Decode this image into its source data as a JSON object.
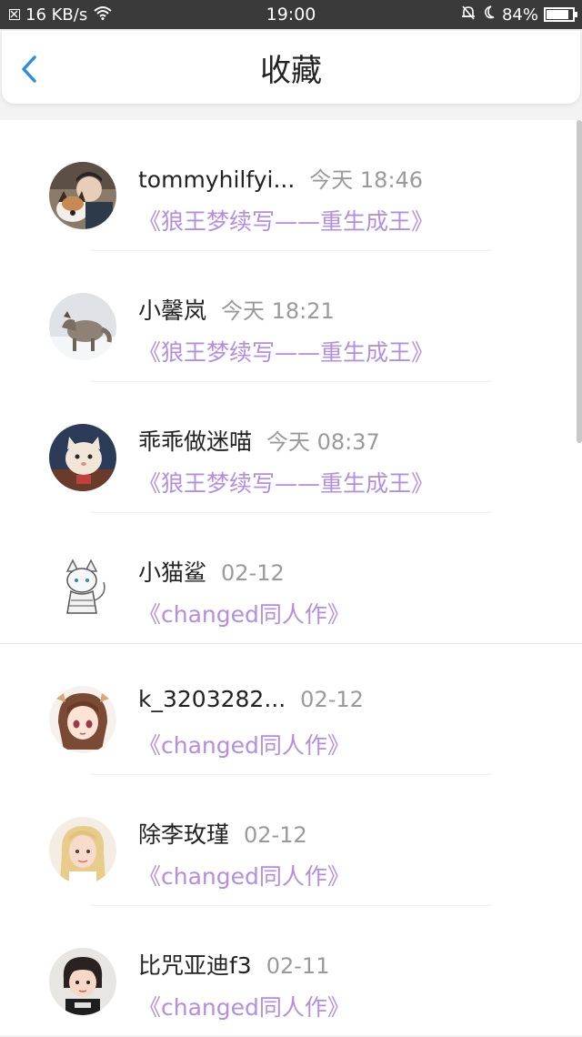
{
  "status_bar": {
    "speed": "16 KB/s",
    "time": "19:00",
    "battery": "84%",
    "battery_level": 0.84
  },
  "header": {
    "title": "收藏",
    "back_icon": "chevron-left-icon"
  },
  "items": [
    {
      "name": "tommyhilfyi...",
      "time": "今天 18:46",
      "title": "《狼王梦续写——重生成王》",
      "avatar": "avatar-boy-with-dog"
    },
    {
      "name": "小馨岚",
      "time": "今天 18:21",
      "title": "《狼王梦续写——重生成王》",
      "avatar": "avatar-wolf"
    },
    {
      "name": "乖乖做迷喵",
      "time": "今天 08:37",
      "title": "《狼王梦续写——重生成王》",
      "avatar": "avatar-cat"
    },
    {
      "name": "小猫鲨",
      "time": "02-12",
      "title": "《changed同人作》",
      "avatar": "avatar-anime-sketch"
    },
    {
      "name": "k_3203282...",
      "time": "02-12",
      "title": "《changed同人作》",
      "avatar": "avatar-anime-girl"
    },
    {
      "name": "除李玫瑾",
      "time": "02-12",
      "title": "《changed同人作》",
      "avatar": "avatar-blonde-girl"
    },
    {
      "name": "比咒亚迪f3",
      "time": "02-11",
      "title": "《changed同人作》",
      "avatar": "avatar-child"
    }
  ]
}
